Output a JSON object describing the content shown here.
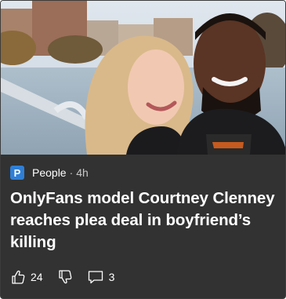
{
  "card": {
    "source": {
      "logo_letter": "P",
      "name": "People",
      "separator": "·",
      "time": "4h"
    },
    "headline": "OnlyFans model Courtney Clenney reaches plea deal in boyfriend’s killing",
    "actions": {
      "like_icon": "thumbs-up-icon",
      "like_count": "24",
      "dislike_icon": "thumbs-down-icon",
      "comment_icon": "comment-icon",
      "comment_count": "3"
    }
  }
}
